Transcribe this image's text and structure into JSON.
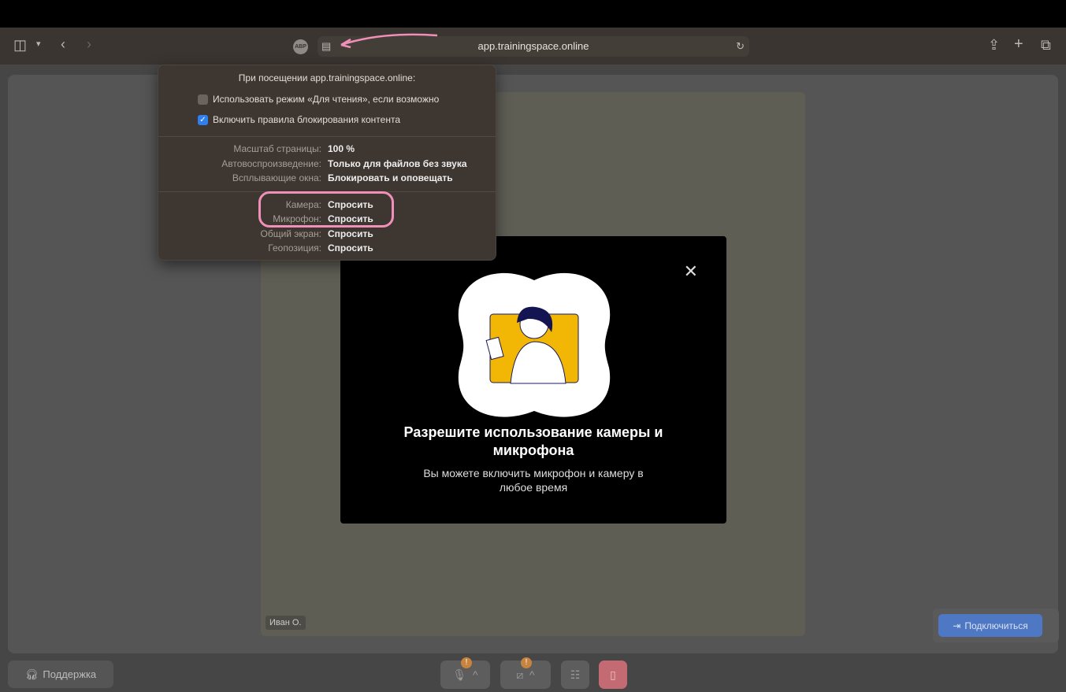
{
  "browser": {
    "url": "app.trainingspace.online",
    "adblock_label": "ABP"
  },
  "popover": {
    "title": "При посещении app.trainingspace.online:",
    "checkboxes": [
      {
        "label": "Использовать режим «Для чтения», если возможно",
        "checked": false
      },
      {
        "label": "Включить правила блокирования контента",
        "checked": true
      }
    ],
    "settings": [
      {
        "label": "Масштаб страницы:",
        "value": "100 %"
      },
      {
        "label": "Автовоспроизведение:",
        "value": "Только для файлов без звука"
      },
      {
        "label": "Всплывающие окна:",
        "value": "Блокировать и оповещать"
      }
    ],
    "permissions": [
      {
        "label": "Камера:",
        "value": "Спросить"
      },
      {
        "label": "Микрофон:",
        "value": "Спросить"
      },
      {
        "label": "Общий экран:",
        "value": "Спросить"
      },
      {
        "label": "Геопозиция:",
        "value": "Спросить"
      }
    ]
  },
  "modal": {
    "title": "Разрешите использование камеры и микрофона",
    "subtitle": "Вы можете включить микрофон и камеру в любое время"
  },
  "participant": {
    "name": "Иван О."
  },
  "join_label": "Подключиться",
  "support_label": "Поддержка",
  "badges": {
    "mic": "!",
    "camera": "!"
  },
  "colors": {
    "accent": "#4f78c4",
    "highlight": "#f08fb8",
    "illustration": "#f2b705",
    "leave": "#c46a73"
  }
}
